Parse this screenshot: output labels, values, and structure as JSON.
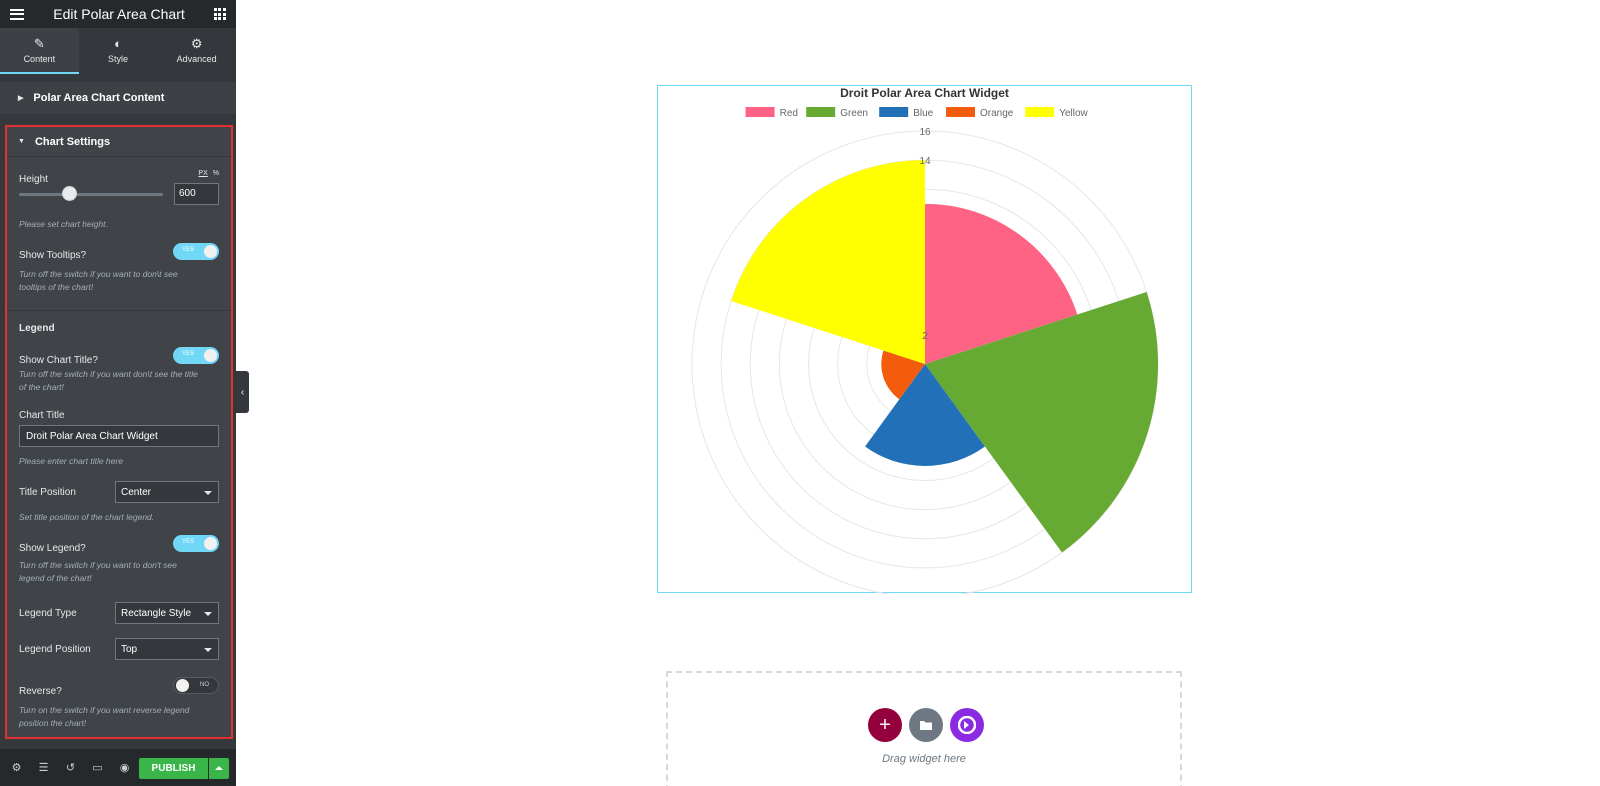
{
  "editor": {
    "title": "Edit Polar Area Chart",
    "tabs": [
      {
        "label": "Content",
        "icon": "pencil-icon"
      },
      {
        "label": "Style",
        "icon": "half-circle-icon"
      },
      {
        "label": "Advanced",
        "icon": "gear-icon"
      }
    ],
    "sections": {
      "content": "Polar Area Chart Content",
      "settings": "Chart Settings"
    }
  },
  "settings": {
    "height": {
      "label": "Height",
      "unit_px": "PX",
      "unit_pct": "%",
      "value": "600",
      "slider_fraction": 0.35,
      "hint": "Please set chart height."
    },
    "tooltips": {
      "label": "Show Tooltips?",
      "state": "YES",
      "hint_1": "Turn off the switch if you want to don\\t see",
      "hint_2": "tooltips of the chart!"
    },
    "legend_heading": "Legend",
    "show_title": {
      "label": "Show Chart Title?",
      "state": "YES",
      "hint_1": "Turn off the switch if you want don\\t see the title",
      "hint_2": "of the chart!"
    },
    "chart_title": {
      "label": "Chart Title",
      "value": "Droit Polar Area Chart Widget",
      "hint": "Please enter chart title here"
    },
    "title_position": {
      "label": "Title Position",
      "value": "Center",
      "hint": "Set title position of the chart legend."
    },
    "show_legend": {
      "label": "Show Legend?",
      "state": "YES",
      "hint_1": "Turn off the switch if you want to don't see",
      "hint_2": "legend of the chart!"
    },
    "legend_type": {
      "label": "Legend Type",
      "value": "Rectangle Style"
    },
    "legend_position": {
      "label": "Legend Position",
      "value": "Top"
    },
    "reverse": {
      "label": "Reverse?",
      "state": "NO",
      "hint_1": "Turn on the switch if you want reverse legend",
      "hint_2": "position the chart!"
    }
  },
  "footer": {
    "icons": [
      "gear-icon",
      "layers-icon",
      "history-icon",
      "responsive-icon",
      "eye-icon"
    ],
    "publish": "PUBLISH"
  },
  "dropzone": {
    "text": "Drag widget here",
    "buttons": [
      "add-icon",
      "folder-icon",
      "droit-logo-icon"
    ],
    "colors": [
      "#93003c",
      "#6d7882",
      "#8a2be2"
    ]
  },
  "chart_data": {
    "type": "polarArea",
    "title": "Droit Polar Area Chart Widget",
    "legend_position": "top",
    "categories": [
      "Red",
      "Green",
      "Blue",
      "Orange",
      "Yellow"
    ],
    "values": [
      11,
      16,
      7,
      3,
      14
    ],
    "colors": [
      "#ff6384",
      "#66aa33",
      "#2271b8",
      "#f35c0c",
      "#ffff00"
    ],
    "r_ticks": [
      "2",
      "14",
      "16"
    ],
    "r_max": 16
  }
}
